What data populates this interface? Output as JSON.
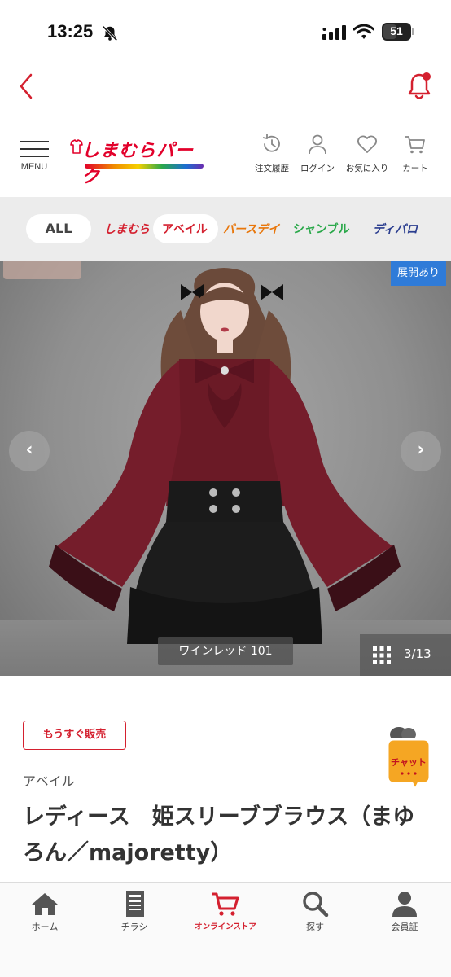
{
  "status_bar": {
    "time": "13:25",
    "battery": "51",
    "battery_level": 0.51
  },
  "header_icons": [
    {
      "label": "注文履歴",
      "icon": "history-icon"
    },
    {
      "label": "ログイン",
      "icon": "user-icon"
    },
    {
      "label": "お気に入り",
      "icon": "heart-icon"
    },
    {
      "label": "カート",
      "icon": "cart-icon"
    }
  ],
  "menu": {
    "label": "MENU"
  },
  "logo": {
    "text": "しまむらパーク"
  },
  "brands": {
    "all": "ALL",
    "items": [
      {
        "label": "しまむら",
        "color": "#d4202f"
      },
      {
        "label": "アベイル",
        "color": "#d4202f"
      },
      {
        "label": "バースデイ",
        "color": "#e8760a"
      },
      {
        "label": "シャンブル",
        "color": "#2aa84a"
      },
      {
        "label": "ディバロ",
        "color": "#2a3d8f"
      }
    ]
  },
  "gallery": {
    "badge": "展開あり",
    "color_label": "ワインレッド 101",
    "count": "3/13",
    "current": 3,
    "total": 13
  },
  "product": {
    "status_badge": "もうすぐ販売",
    "brand": "アベイル",
    "title": "レディース　姫スリーブブラウス（まゆろん／majoretty）"
  },
  "chat": {
    "label": "チャット"
  },
  "bottom_nav": [
    {
      "label": "ホーム",
      "icon": "home-icon"
    },
    {
      "label": "チラシ",
      "icon": "flyer-icon"
    },
    {
      "label": "オンラインストア",
      "icon": "cart-icon",
      "active": true
    },
    {
      "label": "探す",
      "icon": "search-icon"
    },
    {
      "label": "会員証",
      "icon": "member-icon"
    }
  ],
  "colors": {
    "accent": "#d4202f",
    "badge_blue": "#2f7bd8"
  }
}
